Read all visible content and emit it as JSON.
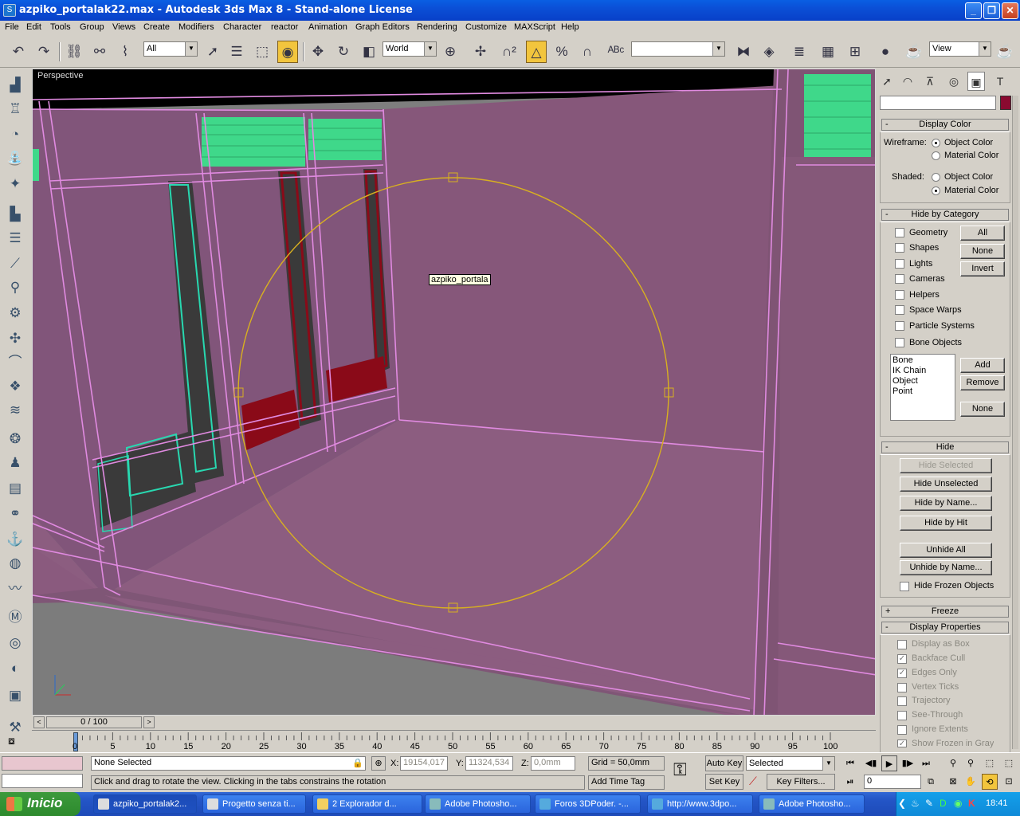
{
  "window": {
    "title": "azpiko_portalak22.max - Autodesk 3ds Max 8  - Stand-alone License"
  },
  "menu": [
    "File",
    "Edit",
    "Tools",
    "Group",
    "Views",
    "Create",
    "Modifiers",
    "Character",
    "reactor",
    "Animation",
    "Graph Editors",
    "Rendering",
    "Customize",
    "MAXScript",
    "Help"
  ],
  "toolbar": {
    "selection_filter": "All",
    "ref_coord": "World",
    "named_selection": "",
    "render_view": "View"
  },
  "viewport": {
    "label": "Perspective",
    "tooltip": "azpiko_portala"
  },
  "command_panel": {
    "display_color": {
      "header": "Display Color",
      "wireframe_label": "Wireframe:",
      "wireframe_options": [
        "Object Color",
        "Material Color"
      ],
      "wireframe_selected": "Object Color",
      "shaded_label": "Shaded:",
      "shaded_options": [
        "Object Color",
        "Material Color"
      ],
      "shaded_selected": "Material Color"
    },
    "hide_by_category": {
      "header": "Hide by Category",
      "categories": [
        "Geometry",
        "Shapes",
        "Lights",
        "Cameras",
        "Helpers",
        "Space Warps",
        "Particle Systems",
        "Bone Objects"
      ],
      "btn_all": "All",
      "btn_none": "None",
      "btn_invert": "Invert",
      "list": [
        "Bone",
        "IK Chain Object",
        "Point"
      ],
      "btn_add": "Add",
      "btn_remove": "Remove",
      "btn_none2": "None"
    },
    "hide": {
      "header": "Hide",
      "hide_selected": "Hide Selected",
      "hide_unselected": "Hide Unselected",
      "hide_by_name": "Hide by Name...",
      "hide_by_hit": "Hide by Hit",
      "unhide_all": "Unhide All",
      "unhide_by_name": "Unhide by Name...",
      "hide_frozen": "Hide Frozen Objects"
    },
    "freeze": {
      "header": "Freeze"
    },
    "display_properties": {
      "header": "Display Properties",
      "items": [
        {
          "label": "Display as Box",
          "checked": false
        },
        {
          "label": "Backface Cull",
          "checked": true
        },
        {
          "label": "Edges Only",
          "checked": true
        },
        {
          "label": "Vertex Ticks",
          "checked": false
        },
        {
          "label": "Trajectory",
          "checked": false
        },
        {
          "label": "See-Through",
          "checked": false
        },
        {
          "label": "Ignore Extents",
          "checked": false
        },
        {
          "label": "Show Frozen in Gray",
          "checked": true
        }
      ]
    }
  },
  "timeline": {
    "frame": "0 / 100",
    "ticks": [
      "0",
      "5",
      "10",
      "15",
      "20",
      "25",
      "30",
      "35",
      "40",
      "45",
      "50",
      "55",
      "60",
      "65",
      "70",
      "75",
      "80",
      "85",
      "90",
      "95",
      "100"
    ]
  },
  "status": {
    "selection": "None Selected",
    "prompt": "Click and drag to rotate the view.  Clicking in the tabs constrains the rotation",
    "x_label": "X:",
    "x": "19154,017",
    "y_label": "Y:",
    "y": "11324,534",
    "z_label": "Z:",
    "z": "0,0mm",
    "grid": "Grid = 50,0mm",
    "add_time_tag": "Add Time Tag",
    "auto_key": "Auto Key",
    "set_key": "Set Key",
    "key_mode": "Selected",
    "key_filters": "Key Filters...",
    "current_frame": "0"
  },
  "taskbar": {
    "start": "Inicio",
    "tasks": [
      "azpiko_portalak2...",
      "Progetto senza ti...",
      "2 Explorador d...",
      "Adobe Photosho...",
      "Foros 3DPoder. -...",
      "http://www.3dpo...",
      "Adobe Photosho..."
    ],
    "clock": "18:41"
  },
  "colors": {
    "wall": "#8a5c7a",
    "wall_dark": "#7d5271",
    "edges": "#e08ae0",
    "gizmo": "#d8b020",
    "window_green": "#3fd88a",
    "window_red": "#8a0a18",
    "window_cyan": "#28d8b0",
    "object_color_swatch": "#8a0a30"
  }
}
